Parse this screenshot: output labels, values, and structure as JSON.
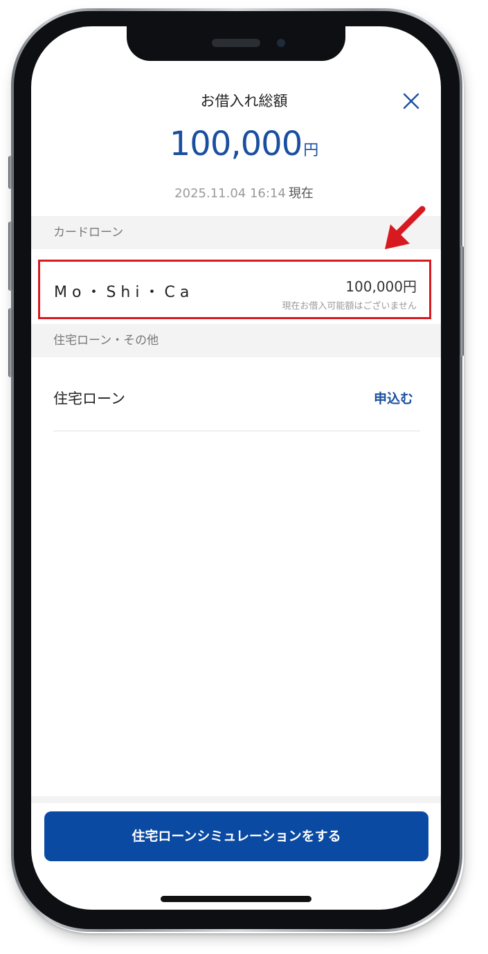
{
  "header": {
    "title": "お借入れ総額",
    "close_icon": "close-icon"
  },
  "total": {
    "amount": "100,000",
    "unit": "円",
    "timestamp": "2025.11.04 16:14",
    "timestamp_suffix": "現在"
  },
  "sections": {
    "card_loan_header": "カードローン",
    "housing_header": "住宅ローン・その他"
  },
  "card_loan": {
    "name": "Mo・Shi・Ca",
    "amount": "100,000円",
    "note": "現在お借入可能額はございません"
  },
  "housing_loan": {
    "label": "住宅ローン",
    "apply_link": "申込む"
  },
  "cta": {
    "label": "住宅ローンシミュレーションをする"
  },
  "colors": {
    "accent": "#1a4fa0",
    "button": "#0b4aa2",
    "highlight": "#d71a20"
  }
}
